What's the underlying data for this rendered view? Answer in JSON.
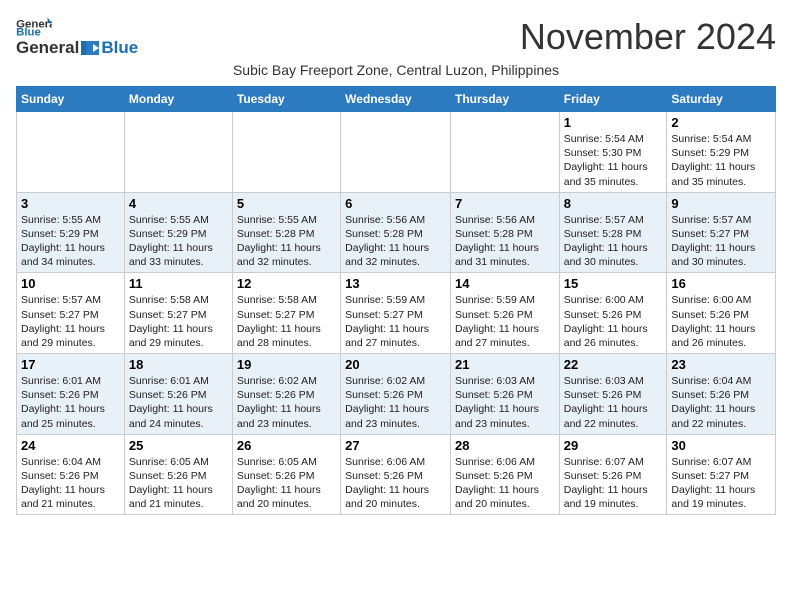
{
  "header": {
    "logo_line1": "General",
    "logo_line2": "Blue",
    "month_title": "November 2024",
    "subtitle": "Subic Bay Freeport Zone, Central Luzon, Philippines"
  },
  "weekdays": [
    "Sunday",
    "Monday",
    "Tuesday",
    "Wednesday",
    "Thursday",
    "Friday",
    "Saturday"
  ],
  "weeks": [
    [
      {
        "day": "",
        "info": ""
      },
      {
        "day": "",
        "info": ""
      },
      {
        "day": "",
        "info": ""
      },
      {
        "day": "",
        "info": ""
      },
      {
        "day": "",
        "info": ""
      },
      {
        "day": "1",
        "info": "Sunrise: 5:54 AM\nSunset: 5:30 PM\nDaylight: 11 hours and 35 minutes."
      },
      {
        "day": "2",
        "info": "Sunrise: 5:54 AM\nSunset: 5:29 PM\nDaylight: 11 hours and 35 minutes."
      }
    ],
    [
      {
        "day": "3",
        "info": "Sunrise: 5:55 AM\nSunset: 5:29 PM\nDaylight: 11 hours and 34 minutes."
      },
      {
        "day": "4",
        "info": "Sunrise: 5:55 AM\nSunset: 5:29 PM\nDaylight: 11 hours and 33 minutes."
      },
      {
        "day": "5",
        "info": "Sunrise: 5:55 AM\nSunset: 5:28 PM\nDaylight: 11 hours and 32 minutes."
      },
      {
        "day": "6",
        "info": "Sunrise: 5:56 AM\nSunset: 5:28 PM\nDaylight: 11 hours and 32 minutes."
      },
      {
        "day": "7",
        "info": "Sunrise: 5:56 AM\nSunset: 5:28 PM\nDaylight: 11 hours and 31 minutes."
      },
      {
        "day": "8",
        "info": "Sunrise: 5:57 AM\nSunset: 5:28 PM\nDaylight: 11 hours and 30 minutes."
      },
      {
        "day": "9",
        "info": "Sunrise: 5:57 AM\nSunset: 5:27 PM\nDaylight: 11 hours and 30 minutes."
      }
    ],
    [
      {
        "day": "10",
        "info": "Sunrise: 5:57 AM\nSunset: 5:27 PM\nDaylight: 11 hours and 29 minutes."
      },
      {
        "day": "11",
        "info": "Sunrise: 5:58 AM\nSunset: 5:27 PM\nDaylight: 11 hours and 29 minutes."
      },
      {
        "day": "12",
        "info": "Sunrise: 5:58 AM\nSunset: 5:27 PM\nDaylight: 11 hours and 28 minutes."
      },
      {
        "day": "13",
        "info": "Sunrise: 5:59 AM\nSunset: 5:27 PM\nDaylight: 11 hours and 27 minutes."
      },
      {
        "day": "14",
        "info": "Sunrise: 5:59 AM\nSunset: 5:26 PM\nDaylight: 11 hours and 27 minutes."
      },
      {
        "day": "15",
        "info": "Sunrise: 6:00 AM\nSunset: 5:26 PM\nDaylight: 11 hours and 26 minutes."
      },
      {
        "day": "16",
        "info": "Sunrise: 6:00 AM\nSunset: 5:26 PM\nDaylight: 11 hours and 26 minutes."
      }
    ],
    [
      {
        "day": "17",
        "info": "Sunrise: 6:01 AM\nSunset: 5:26 PM\nDaylight: 11 hours and 25 minutes."
      },
      {
        "day": "18",
        "info": "Sunrise: 6:01 AM\nSunset: 5:26 PM\nDaylight: 11 hours and 24 minutes."
      },
      {
        "day": "19",
        "info": "Sunrise: 6:02 AM\nSunset: 5:26 PM\nDaylight: 11 hours and 23 minutes."
      },
      {
        "day": "20",
        "info": "Sunrise: 6:02 AM\nSunset: 5:26 PM\nDaylight: 11 hours and 23 minutes."
      },
      {
        "day": "21",
        "info": "Sunrise: 6:03 AM\nSunset: 5:26 PM\nDaylight: 11 hours and 23 minutes."
      },
      {
        "day": "22",
        "info": "Sunrise: 6:03 AM\nSunset: 5:26 PM\nDaylight: 11 hours and 22 minutes."
      },
      {
        "day": "23",
        "info": "Sunrise: 6:04 AM\nSunset: 5:26 PM\nDaylight: 11 hours and 22 minutes."
      }
    ],
    [
      {
        "day": "24",
        "info": "Sunrise: 6:04 AM\nSunset: 5:26 PM\nDaylight: 11 hours and 21 minutes."
      },
      {
        "day": "25",
        "info": "Sunrise: 6:05 AM\nSunset: 5:26 PM\nDaylight: 11 hours and 21 minutes."
      },
      {
        "day": "26",
        "info": "Sunrise: 6:05 AM\nSunset: 5:26 PM\nDaylight: 11 hours and 20 minutes."
      },
      {
        "day": "27",
        "info": "Sunrise: 6:06 AM\nSunset: 5:26 PM\nDaylight: 11 hours and 20 minutes."
      },
      {
        "day": "28",
        "info": "Sunrise: 6:06 AM\nSunset: 5:26 PM\nDaylight: 11 hours and 20 minutes."
      },
      {
        "day": "29",
        "info": "Sunrise: 6:07 AM\nSunset: 5:26 PM\nDaylight: 11 hours and 19 minutes."
      },
      {
        "day": "30",
        "info": "Sunrise: 6:07 AM\nSunset: 5:27 PM\nDaylight: 11 hours and 19 minutes."
      }
    ]
  ]
}
